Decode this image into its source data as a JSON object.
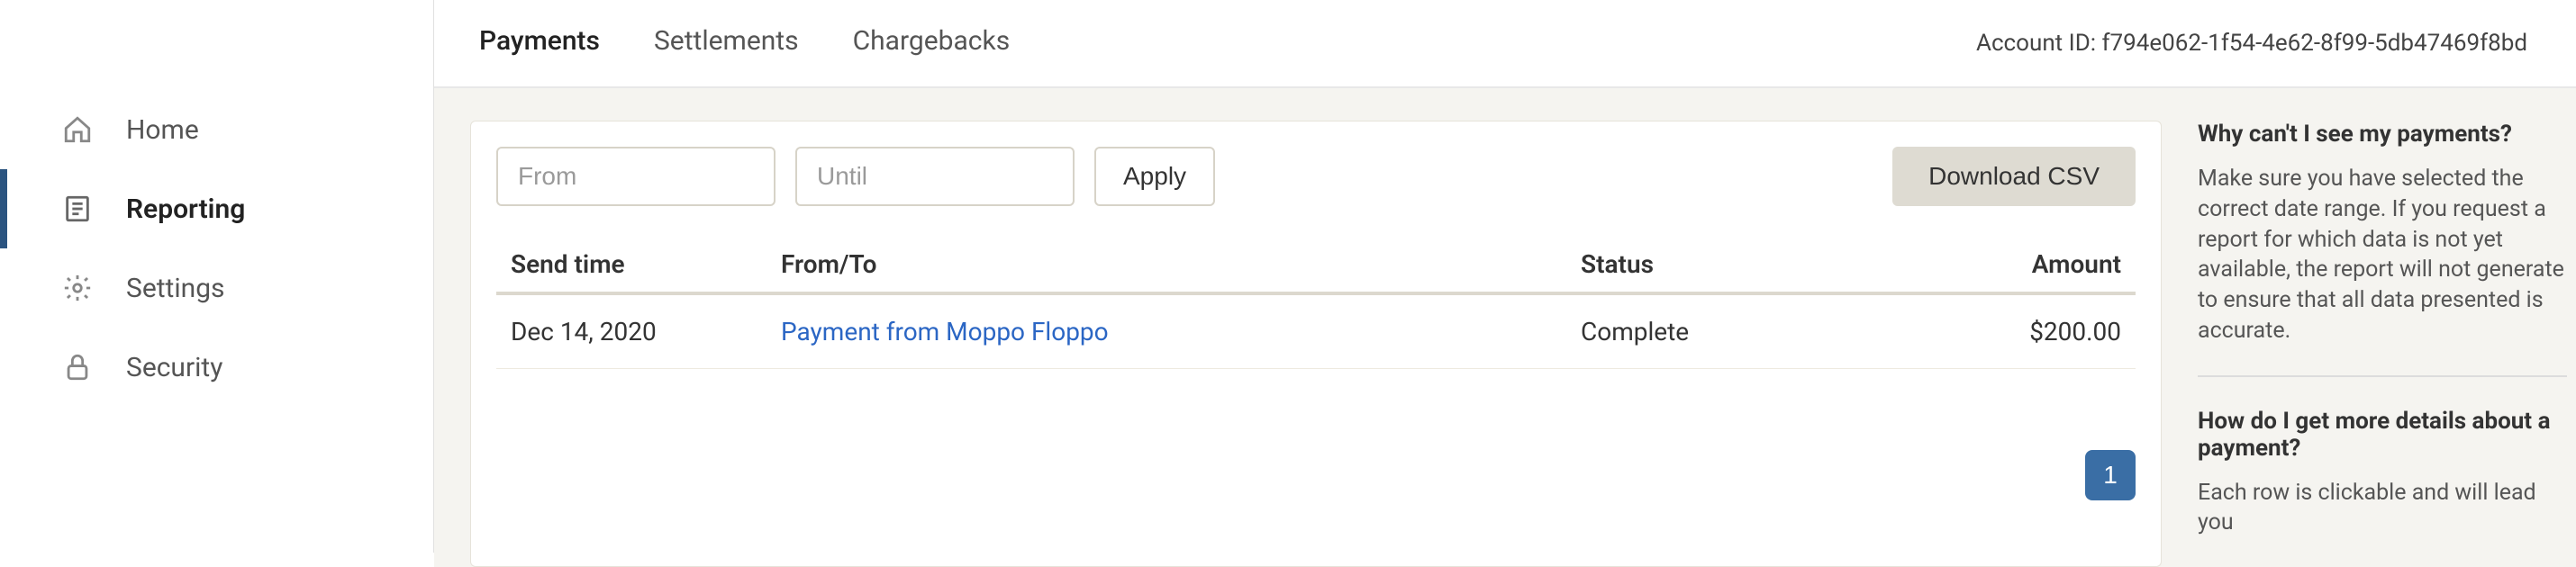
{
  "sidebar": {
    "items": [
      {
        "label": "Home"
      },
      {
        "label": "Reporting"
      },
      {
        "label": "Settings"
      },
      {
        "label": "Security"
      }
    ]
  },
  "tabs": [
    {
      "label": "Payments"
    },
    {
      "label": "Settlements"
    },
    {
      "label": "Chargebacks"
    }
  ],
  "account_id_label": "Account ID: f794e062-1f54-4e62-8f99-5db47469f8bd",
  "filters": {
    "from_placeholder": "From",
    "until_placeholder": "Until",
    "apply_label": "Apply",
    "download_label": "Download CSV"
  },
  "table": {
    "headers": {
      "sendtime": "Send time",
      "fromto": "From/To",
      "status": "Status",
      "amount": "Amount"
    },
    "rows": [
      {
        "sendtime": "Dec 14, 2020",
        "fromto": "Payment from Moppo Floppo",
        "status": "Complete",
        "amount": "$200.00"
      }
    ]
  },
  "pagination": {
    "current": "1"
  },
  "help": {
    "q1_title": "Why can't I see my payments?",
    "q1_body": "Make sure you have selected the correct date range. If you request a report for which data is not yet available, the report will not generate to ensure that all data presented is accurate.",
    "q2_title": "How do I get more details about a payment?",
    "q2_body": "Each row is clickable and will lead you"
  }
}
